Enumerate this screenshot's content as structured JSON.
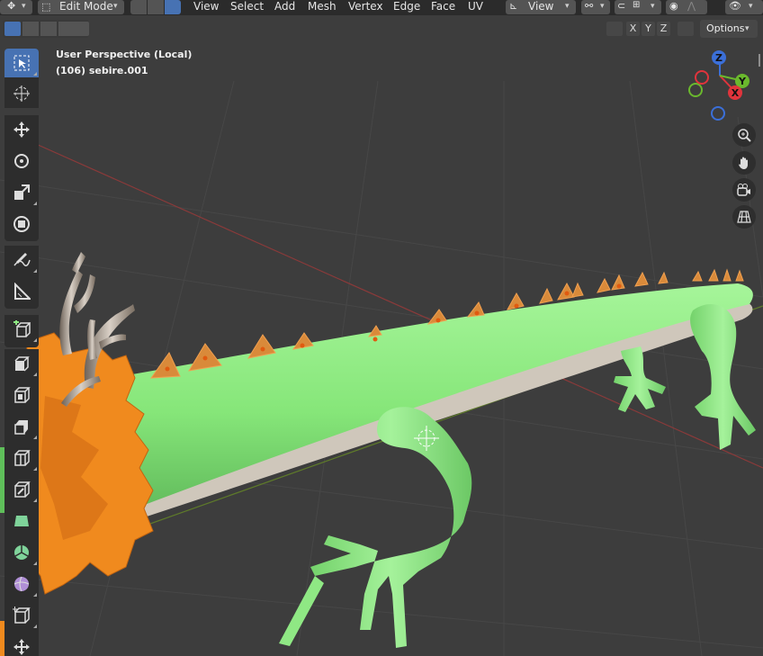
{
  "header": {
    "mode_label": "Edit Mode",
    "menus": [
      "View",
      "Select",
      "Add",
      "Mesh",
      "Vertex",
      "Edge",
      "Face",
      "UV"
    ],
    "transform_orientation": "View",
    "options_label": "Options",
    "axis_toggles": [
      "X",
      "Y",
      "Z"
    ]
  },
  "viewport": {
    "perspective_label": "User Perspective (Local)",
    "object_label": "(106) sebire.001"
  },
  "gizmo": {
    "x_label": "X",
    "y_label": "Y",
    "z_label": "Z"
  },
  "toolbar": {
    "tools": [
      "select-box",
      "cursor",
      "move",
      "rotate",
      "scale",
      "transform",
      "annotate",
      "measure",
      "add-cube",
      "extrude-region",
      "inset-faces",
      "bevel",
      "loop-cut",
      "knife",
      "poly-build",
      "spin",
      "smooth",
      "shrink-fatten",
      "shear"
    ]
  },
  "colors": {
    "viewport_bg": "#3d3d3d",
    "header_bg": "#2b2b2b",
    "active_tool": "#4772b3",
    "mesh_green": "#8de882",
    "mesh_orange": "#f08a1e",
    "antler": "#a89a8a"
  }
}
